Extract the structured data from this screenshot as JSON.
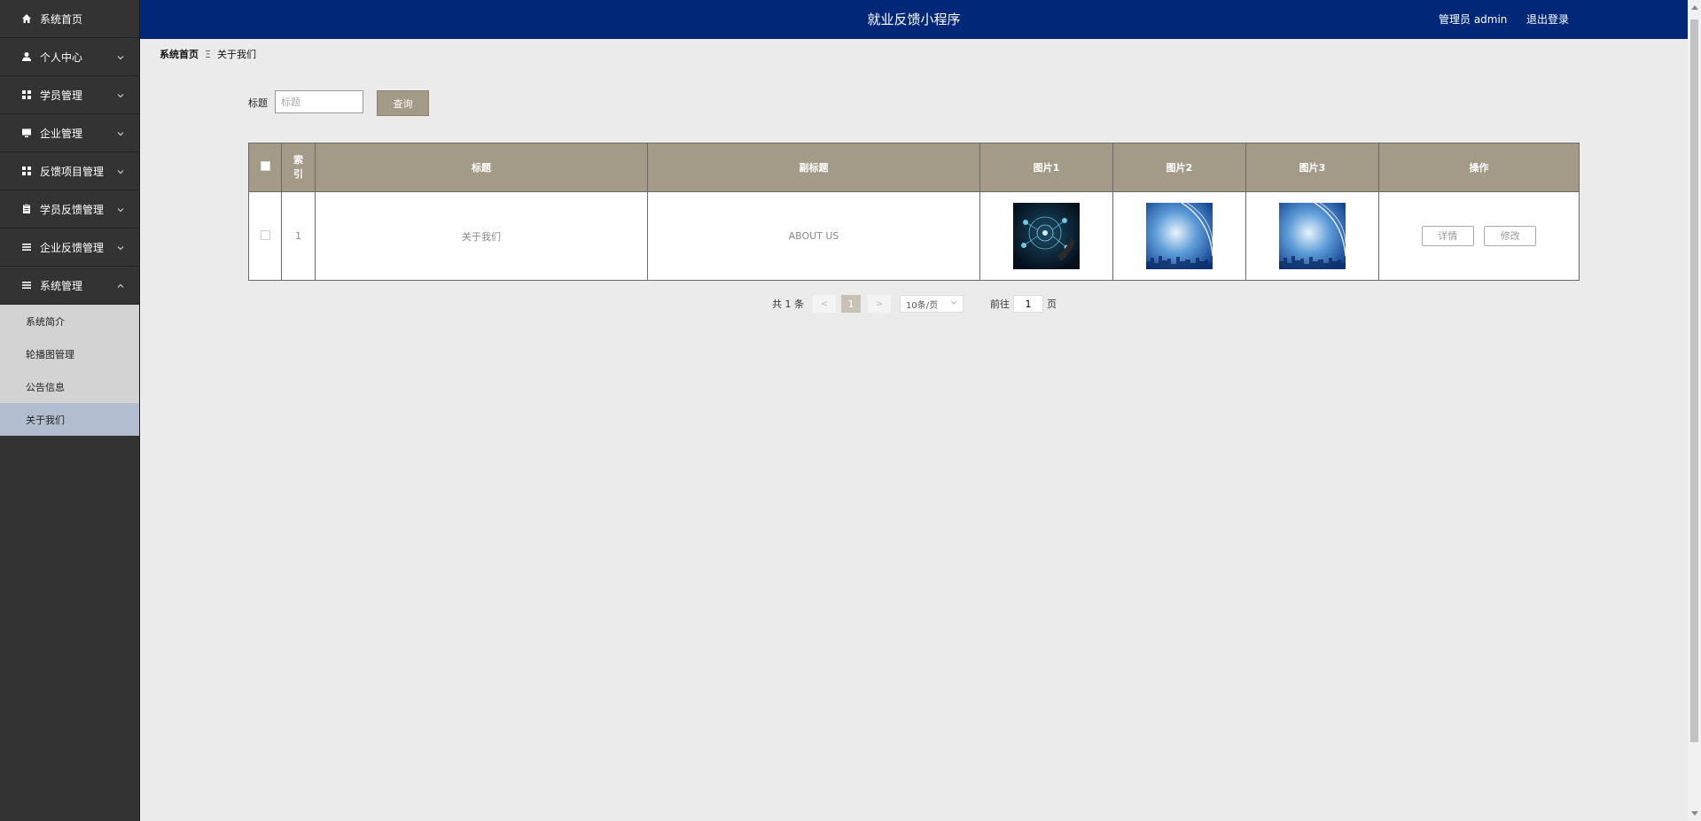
{
  "sidebar": {
    "items": [
      {
        "label": "系统首页",
        "icon": "home-icon",
        "has_arrow": false
      },
      {
        "label": "个人中心",
        "icon": "user-icon",
        "has_arrow": true
      },
      {
        "label": "学员管理",
        "icon": "grid-icon",
        "has_arrow": true
      },
      {
        "label": "企业管理",
        "icon": "monitor-icon",
        "has_arrow": true
      },
      {
        "label": "反馈项目管理",
        "icon": "grid-icon",
        "has_arrow": true
      },
      {
        "label": "学员反馈管理",
        "icon": "clipboard-icon",
        "has_arrow": true
      },
      {
        "label": "企业反馈管理",
        "icon": "list-icon",
        "has_arrow": true
      },
      {
        "label": "系统管理",
        "icon": "list-icon",
        "has_arrow": true,
        "expanded": true
      }
    ],
    "submenu": [
      {
        "label": "系统简介",
        "active": false
      },
      {
        "label": "轮播图管理",
        "active": false
      },
      {
        "label": "公告信息",
        "active": false
      },
      {
        "label": "关于我们",
        "active": true
      }
    ]
  },
  "header": {
    "title": "就业反馈小程序",
    "user": "管理员 admin",
    "logout": "退出登录"
  },
  "breadcrumb": {
    "home": "系统首页",
    "separator": "Ξ",
    "current": "关于我们"
  },
  "search": {
    "label": "标题",
    "placeholder": "标题",
    "button": "查询"
  },
  "table": {
    "headers": {
      "index": "索引",
      "title": "标题",
      "subtitle": "副标题",
      "image1": "图片1",
      "image2": "图片2",
      "image3": "图片3",
      "actions": "操作"
    },
    "rows": [
      {
        "index": "1",
        "title": "关于我们",
        "subtitle": "ABOUT US",
        "detail": "详情",
        "edit": "修改"
      }
    ]
  },
  "pagination": {
    "total": "共 1 条",
    "prev": "<",
    "current_page": "1",
    "next": ">",
    "page_size": "10条/页",
    "goto_label": "前往",
    "goto_value": "1",
    "goto_suffix": "页"
  },
  "colors": {
    "header_bg": "#012878",
    "sidebar_bg": "#333333",
    "table_header_bg": "#a49a88",
    "active_submenu_bg": "#b3bdd0"
  }
}
